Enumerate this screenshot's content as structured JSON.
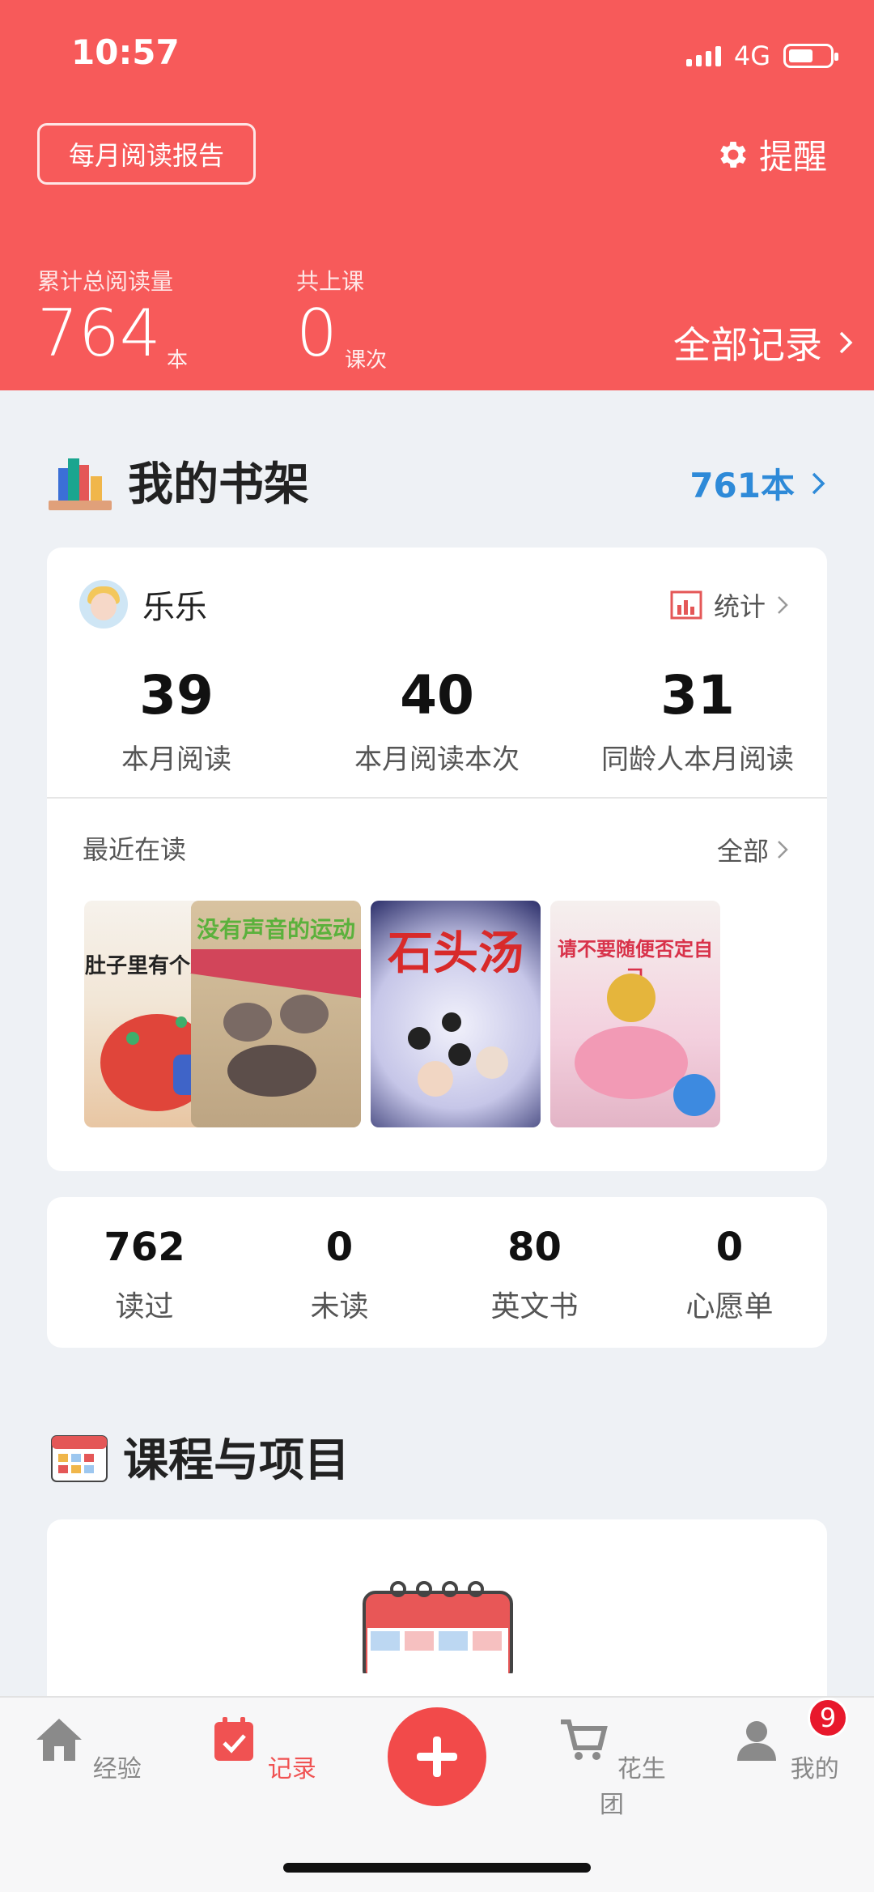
{
  "status_bar": {
    "time": "10:57",
    "network": "4G"
  },
  "header": {
    "report_button": "每月阅读报告",
    "remind_label": "提醒",
    "total_reading_label": "累计总阅读量",
    "total_reading_value": "764",
    "total_reading_unit": "本",
    "classes_label": "共上课",
    "classes_value": "0",
    "classes_unit": "课次",
    "all_records_label": "全部记录"
  },
  "bookshelf": {
    "title": "我的书架",
    "count_link": "761本",
    "child_name": "乐乐",
    "stats_link": "统计",
    "monthly": [
      {
        "value": "39",
        "label": "本月阅读"
      },
      {
        "value": "40",
        "label": "本月阅读本次"
      },
      {
        "value": "31",
        "label": "同龄人本月阅读"
      }
    ],
    "recent_label": "最近在读",
    "recent_all": "全部",
    "books": [
      {
        "title": "肚子里有个火车站"
      },
      {
        "title": "没有声音的运动会"
      },
      {
        "title": "石头汤"
      },
      {
        "title": "请不要随便否定自己"
      }
    ],
    "counts": [
      {
        "value": "762",
        "label": "读过"
      },
      {
        "value": "0",
        "label": "未读"
      },
      {
        "value": "80",
        "label": "英文书"
      },
      {
        "value": "0",
        "label": "心愿单"
      }
    ]
  },
  "courses": {
    "title": "课程与项目"
  },
  "tabbar": {
    "items": [
      {
        "label": "经验"
      },
      {
        "label": "记录"
      },
      {
        "label": "花生团"
      },
      {
        "label": "我的"
      }
    ],
    "badge_count": "9",
    "active_color": "#f05252"
  },
  "colors": {
    "brand_red": "#f75a5a",
    "link_blue": "#2e8ad8"
  }
}
